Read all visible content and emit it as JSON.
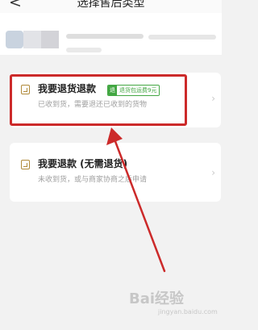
{
  "header": {
    "title": "选择售后类型",
    "back_icon": "chevron-left-icon"
  },
  "options": [
    {
      "title": "我要退货退款",
      "tag": "退货包运费9元",
      "tag_color": "#43a743",
      "description": "已收到货，需要退还已收到的货物",
      "icon": "return-box-icon"
    },
    {
      "title": "我要退款 (无需退货)",
      "description": "未收到货，或与商家协商之后申请",
      "icon": "refund-icon"
    }
  ],
  "annotation": {
    "highlight_color": "#cc2a2a"
  },
  "watermark": {
    "text": "Bai经验",
    "sub": "jingyan.baidu.com"
  }
}
